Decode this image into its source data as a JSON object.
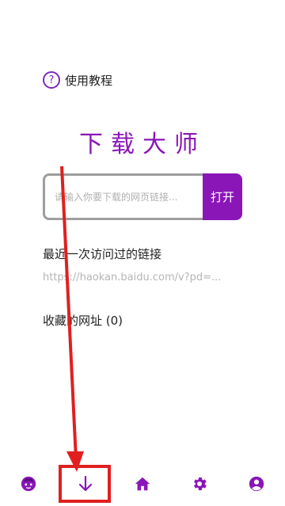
{
  "help": {
    "icon_glyph": "?",
    "label": "使用教程"
  },
  "app_title": "下载大师",
  "url_input": {
    "placeholder": "请输入你要下载的网页链接...",
    "value": ""
  },
  "open_button": "打开",
  "recent": {
    "label": "最近一次访问过的链接",
    "link": "https://haokan.baidu.com/v?pd=..."
  },
  "favorites": {
    "label": "收藏的网址 (0)"
  },
  "bottom_nav": {
    "items": [
      {
        "icon": "face-icon"
      },
      {
        "icon": "download-arrow-icon"
      },
      {
        "icon": "home-icon"
      },
      {
        "icon": "gear-icon"
      },
      {
        "icon": "account-icon"
      }
    ]
  },
  "colors": {
    "accent": "#8a16b8",
    "annotation": "#e0201f"
  }
}
